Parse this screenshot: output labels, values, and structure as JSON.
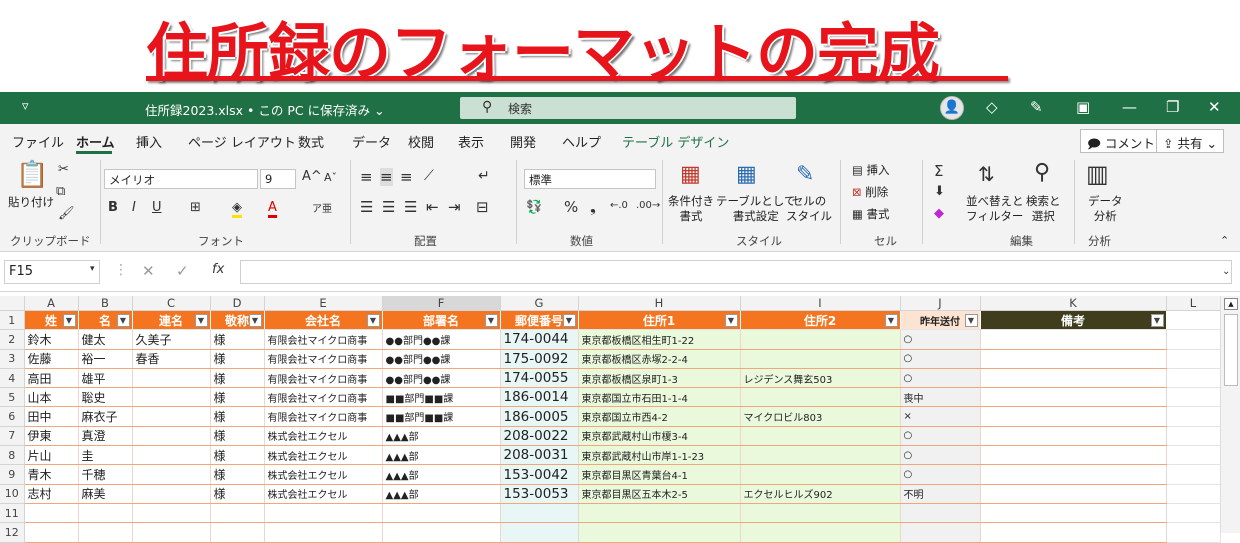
{
  "banner": {
    "title": "住所録のフォーマットの完成"
  },
  "window": {
    "qat": "▿",
    "doc_title": "住所録2023.xlsx • この PC に保存済み ⌄",
    "search": "検索"
  },
  "menus": [
    "ファイル",
    "ホーム",
    "挿入",
    "ページ レイアウト",
    "数式",
    "データ",
    "校閲",
    "表示",
    "開発",
    "ヘルプ",
    "テーブル デザイン"
  ],
  "header_buttons": {
    "comment": "コメント",
    "share": "共有"
  },
  "ribbon": {
    "clipboard": {
      "paste": "貼り付け",
      "label": "クリップボード"
    },
    "font": {
      "name": "メイリオ",
      "size": "9",
      "label": "フォント",
      "bold": "B",
      "italic": "I",
      "underline": "U"
    },
    "align": {
      "label": "配置"
    },
    "number": {
      "format": "標準",
      "label": "数値"
    },
    "style": {
      "cond": "条件付き\n書式",
      "table": "テーブルとして\n書式設定",
      "cell": "セルの\nスタイル",
      "label": "スタイル"
    },
    "cells": {
      "insert": "挿入",
      "delete": "削除",
      "format": "書式",
      "label": "セル"
    },
    "edit": {
      "sortfilter": "並べ替えと\nフィルター",
      "find": "検索と\n選択",
      "label": "編集"
    },
    "analysis": {
      "data": "データ\n分析",
      "label": "分析"
    }
  },
  "formula": {
    "namebox": "F15",
    "fx": "fx",
    "value": ""
  },
  "columns": [
    "A",
    "B",
    "C",
    "D",
    "E",
    "F",
    "G",
    "H",
    "I",
    "J",
    "K",
    "L"
  ],
  "headers": [
    "姓",
    "名",
    "連名",
    "敬称",
    "会社名",
    "部署名",
    "郵便番号",
    "住所1",
    "住所2",
    "昨年送付",
    "備考"
  ],
  "rows": [
    [
      "鈴木",
      "健太",
      "久美子",
      "様",
      "有限会社マイクロ商事",
      "●●部門●●課",
      "174-0044",
      "東京都板橋区相生町1-22",
      "",
      "○",
      ""
    ],
    [
      "佐藤",
      "裕一",
      "春香",
      "様",
      "有限会社マイクロ商事",
      "●●部門●●課",
      "175-0092",
      "東京都板橋区赤塚2-2-4",
      "",
      "○",
      ""
    ],
    [
      "高田",
      "雄平",
      "",
      "様",
      "有限会社マイクロ商事",
      "●●部門●●課",
      "174-0055",
      "東京都板橋区泉町1-3",
      "レジデンス舞玄503",
      "○",
      ""
    ],
    [
      "山本",
      "聡史",
      "",
      "様",
      "有限会社マイクロ商事",
      "■■部門■■課",
      "186-0014",
      "東京都国立市石田1-1-4",
      "",
      "喪中",
      ""
    ],
    [
      "田中",
      "麻衣子",
      "",
      "様",
      "有限会社マイクロ商事",
      "■■部門■■課",
      "186-0005",
      "東京都国立市西4-2",
      "マイクロビル803",
      "×",
      ""
    ],
    [
      "伊東",
      "真澄",
      "",
      "様",
      "株式会社エクセル",
      "▲▲▲部",
      "208-0022",
      "東京都武蔵村山市榎3-4",
      "",
      "○",
      ""
    ],
    [
      "片山",
      "圭",
      "",
      "様",
      "株式会社エクセル",
      "▲▲▲部",
      "208-0031",
      "東京都武蔵村山市岸1-1-23",
      "",
      "○",
      ""
    ],
    [
      "青木",
      "千穂",
      "",
      "様",
      "株式会社エクセル",
      "▲▲▲部",
      "153-0042",
      "東京都目黒区青葉台4-1",
      "",
      "○",
      ""
    ],
    [
      "志村",
      "麻美",
      "",
      "様",
      "株式会社エクセル",
      "▲▲▲部",
      "153-0053",
      "東京都目黒区五本木2-5",
      "エクセルヒルズ902",
      "不明",
      ""
    ]
  ],
  "row_numbers": [
    "1",
    "2",
    "3",
    "4",
    "5",
    "6",
    "7",
    "8",
    "9",
    "10",
    "11",
    "12"
  ],
  "colors": {
    "accent": "#1f7145",
    "header": "#f4741f",
    "title": "#e8141c"
  }
}
